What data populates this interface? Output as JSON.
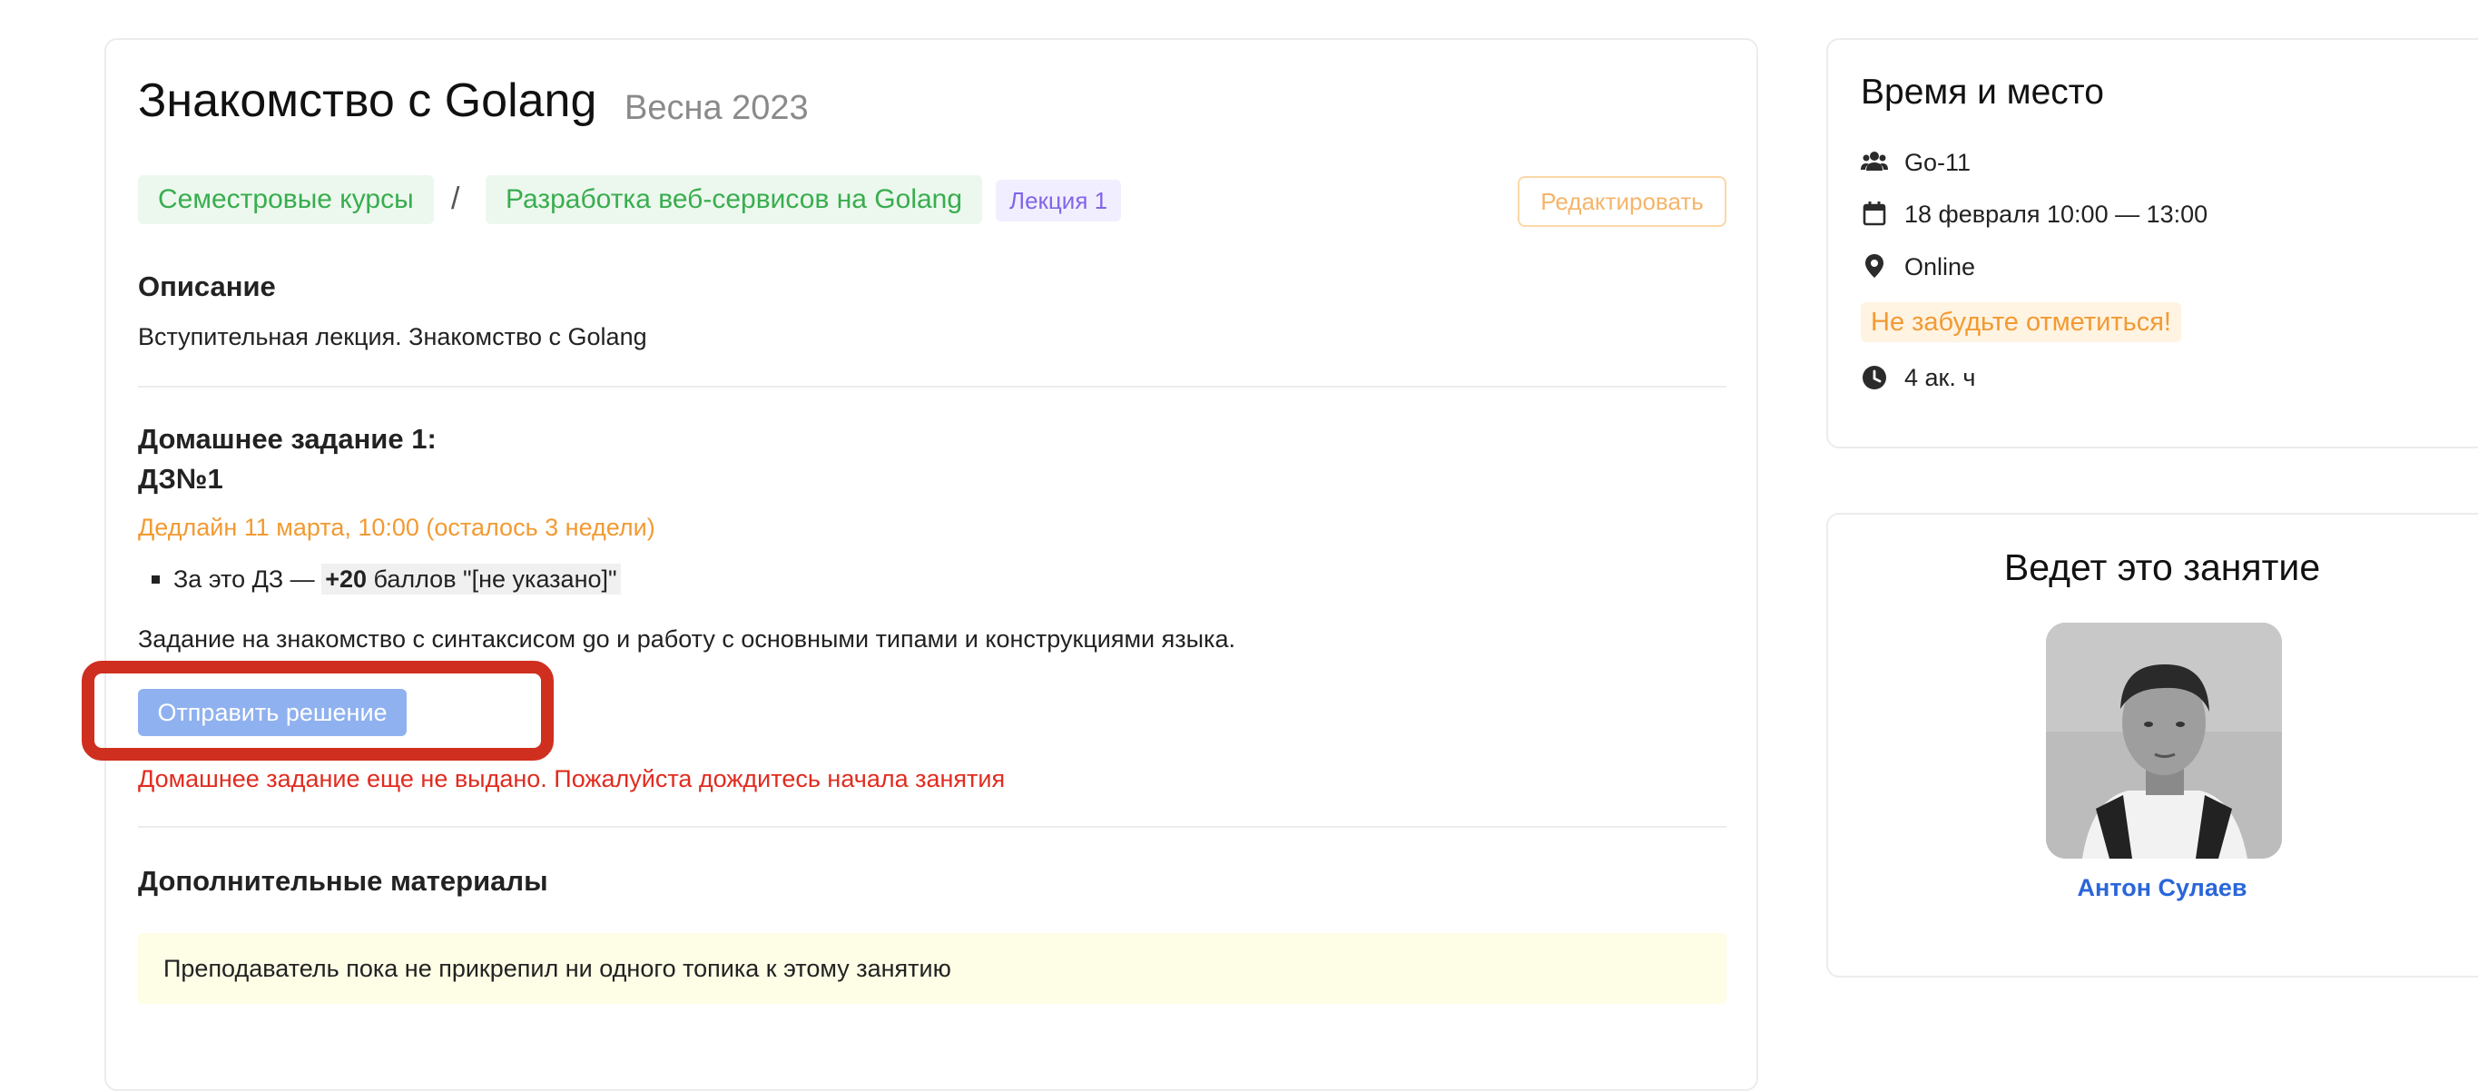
{
  "lesson": {
    "title": "Знакомство с Golang",
    "semester": "Весна 2023"
  },
  "breadcrumb": {
    "items": [
      "Семестровые курсы",
      "Разработка веб-сервисов на Golang"
    ],
    "separator": "/",
    "lecture_tag": "Лекция 1"
  },
  "edit_label": "Редактировать",
  "description": {
    "heading": "Описание",
    "text": "Вступительная лекция. Знакомство с Golang"
  },
  "homework": {
    "heading": "Домашнее задание 1:",
    "name": "ДЗ№1",
    "deadline": "Дедлайн 11 марта, 10:00 (осталось 3 недели)",
    "points_prefix": "За это ДЗ — ",
    "points_value": "+20",
    "points_suffix": " баллов \"[не указано]\"",
    "task": "Задание на знакомство с синтаксисом go и работу с основными типами и конструкциями языка.",
    "submit_label": "Отправить решение",
    "error": "Домашнее задание еще не выдано. Пожалуйста дождитесь начала занятия"
  },
  "materials": {
    "heading": "Дополнительные материалы",
    "empty_notice": "Преподаватель пока не прикрепил ни одного топика к этому занятию"
  },
  "time_place": {
    "heading": "Время и место",
    "group": "Go-11",
    "datetime": "18 февраля 10:00 — 13:00",
    "location": "Online",
    "reminder": "Не забудьте отметиться!",
    "duration": "4 ак. ч"
  },
  "teacher": {
    "heading": "Ведет это занятие",
    "name": "Антон Сулаев"
  },
  "colors": {
    "green_chip_text": "#39ad4f",
    "green_chip_bg": "#ecf8ee",
    "purple_tag": "#8264e8",
    "deadline": "#f29a32",
    "error": "#e12b1f",
    "button_disabled": "#8fb1ef",
    "link": "#2a66d9",
    "highlight_box": "#cf2f1e"
  },
  "icons": {
    "group": "users-icon",
    "date": "calendar-icon",
    "location": "map-pin-icon",
    "duration": "clock-icon"
  }
}
